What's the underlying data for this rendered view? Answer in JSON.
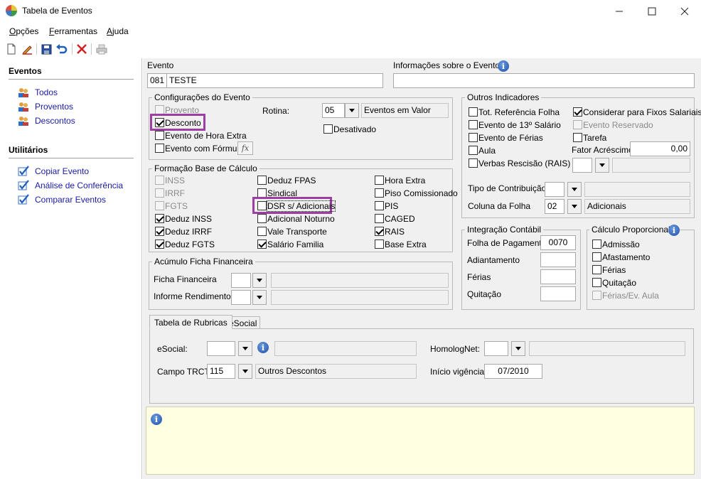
{
  "window": {
    "title": "Tabela de Eventos"
  },
  "menu": [
    {
      "pre": "",
      "u": "O",
      "post": "pções"
    },
    {
      "pre": "",
      "u": "F",
      "post": "erramentas"
    },
    {
      "pre": "",
      "u": "A",
      "post": "juda"
    }
  ],
  "sidebar": {
    "eventos_head": "Eventos",
    "eventos": [
      "Todos",
      "Proventos",
      "Descontos"
    ],
    "utilitarios_head": "Utilitários",
    "utilitarios": [
      "Copiar Evento",
      "Análise de Conferência",
      "Comparar Eventos"
    ]
  },
  "evento": {
    "label": "Evento",
    "code": "081",
    "name": "TESTE",
    "info_label": "Informações sobre o Evento",
    "info_value": ""
  },
  "config": {
    "title": "Configurações do Evento",
    "provento": "Provento",
    "desconto": "Desconto",
    "hora_extra": "Evento de Hora Extra",
    "formula": "Evento com Fórmula",
    "fx": "fx",
    "rotina_label": "Rotina:",
    "rotina_code": "05",
    "rotina_desc": "Eventos em Valor",
    "desativado": "Desativado"
  },
  "formacao": {
    "title": "Formação Base de Cálculo",
    "col1": [
      "INSS",
      "IRRF",
      "FGTS",
      "Deduz INSS",
      "Deduz IRRF",
      "Deduz FGTS"
    ],
    "col2": [
      "Deduz FPAS",
      "Sindical",
      "DSR s/ Adicionais",
      "Adicional Noturno",
      "Vale Transporte",
      "Salário Familia"
    ],
    "col3": [
      "Hora Extra",
      "Piso Comissionado",
      "PIS",
      "CAGED",
      "RAIS",
      "Base Extra"
    ]
  },
  "acumulo": {
    "title": "Acúmulo Ficha Financeira",
    "ficha": "Ficha Financeira",
    "informe": "Informe Rendimentos"
  },
  "outros": {
    "title": "Outros Indicadores",
    "left": [
      "Tot. Referência Folha",
      "Evento de 13º Salário",
      "Evento de Férias",
      "Aula",
      "Verbas Rescisão (RAIS)"
    ],
    "right": [
      "Considerar para Fixos Salariais",
      "Evento Reservado",
      "Tarefa"
    ],
    "fator_label": "Fator Acréscimo",
    "fator_value": "0,00",
    "tipo_contrib": "Tipo de Contribuição",
    "coluna_folha": "Coluna da Folha",
    "coluna_code": "02",
    "coluna_desc": "Adicionais"
  },
  "integracao": {
    "title": "Integração Contábil",
    "folha": "Folha de Pagamento",
    "folha_value": "0070",
    "adiantamento": "Adiantamento",
    "ferias": "Férias",
    "quitacao": "Quitação"
  },
  "calculo": {
    "title": "Cálculo Proporcional",
    "items": [
      "Admissão",
      "Afastamento",
      "Férias",
      "Quitação",
      "Férias/Ev. Aula"
    ]
  },
  "tabs": [
    "Tabela de Rubricas",
    "eSocial"
  ],
  "rubricas": {
    "esocial_label": "eSocial:",
    "homolog_label": "HomologNet:",
    "trct_label": "Campo TRCT:",
    "trct_code": "115",
    "trct_desc": "Outros Descontos",
    "vigencia_label": "Início vigência:",
    "vigencia_value": "07/2010"
  },
  "colors": {
    "highlight": "#9b3fa3",
    "link": "#1a1aa6",
    "info_bg": "#ffffe1"
  }
}
